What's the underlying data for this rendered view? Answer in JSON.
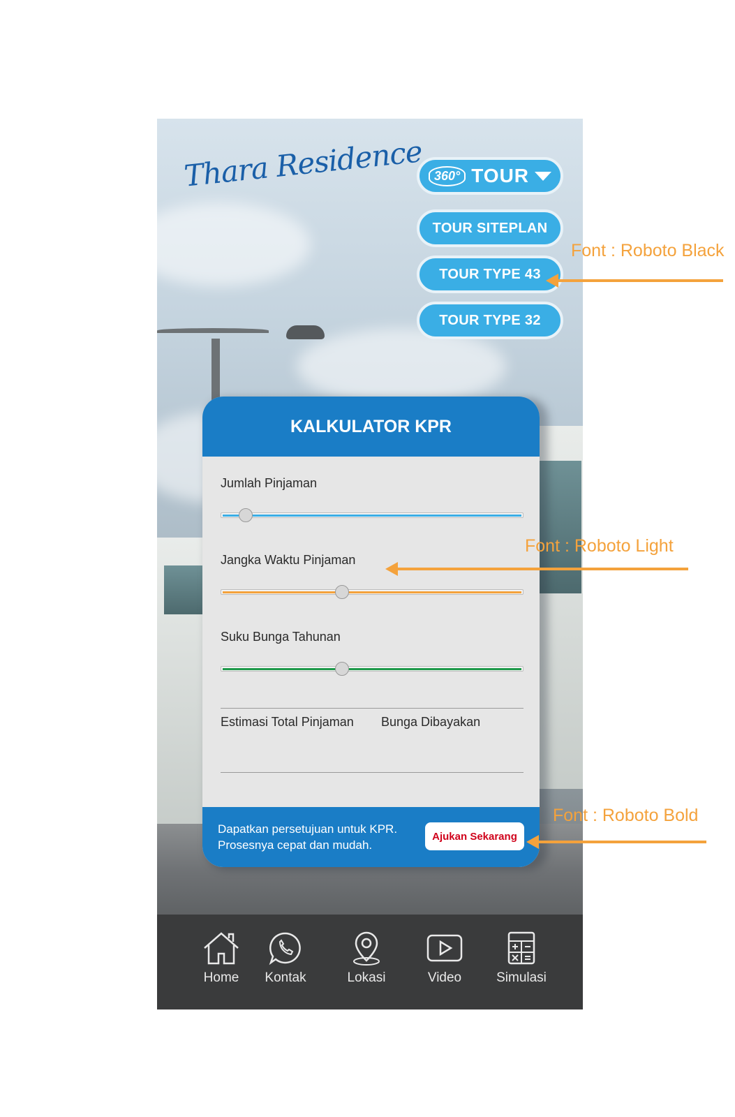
{
  "logo_text": "Thara Residence",
  "tour_menu": {
    "badge": "360°",
    "label": "TOUR",
    "items": [
      "TOUR SITEPLAN",
      "TOUR TYPE 43",
      "TOUR TYPE 32"
    ]
  },
  "calculator": {
    "title": "KALKULATOR KPR",
    "fields": [
      {
        "label": "Jumlah Pinjaman",
        "color": "#3aaee5",
        "value": 0.08
      },
      {
        "label": "Jangka Waktu  Pinjaman",
        "color": "#f4a23c",
        "value": 0.4
      },
      {
        "label": "Suku Bunga Tahunan",
        "color": "#1f9a4a",
        "value": 0.4
      }
    ],
    "estimate_label": "Estimasi Total Pinjaman",
    "interest_label": "Bunga Dibayakan",
    "footer_line1": "Dapatkan persetujuan untuk KPR.",
    "footer_line2": "Prosesnya cepat dan mudah.",
    "apply_button": "Ajukan Sekarang"
  },
  "nav": [
    {
      "label": "Home",
      "icon": "home-icon"
    },
    {
      "label": "Kontak",
      "icon": "whatsapp-icon"
    },
    {
      "label": "Lokasi",
      "icon": "location-pin-icon"
    },
    {
      "label": "Video",
      "icon": "play-icon"
    },
    {
      "label": "Simulasi",
      "icon": "calculator-icon"
    }
  ],
  "annotations": {
    "black": "Font : Roboto Black",
    "light": "Font : Roboto Light",
    "bold": "Font : Roboto Bold"
  },
  "colors": {
    "accent_blue": "#3aaee5",
    "card_blue": "#1a7dc6",
    "annotation_orange": "#f4a23c",
    "apply_red": "#d0021b"
  }
}
